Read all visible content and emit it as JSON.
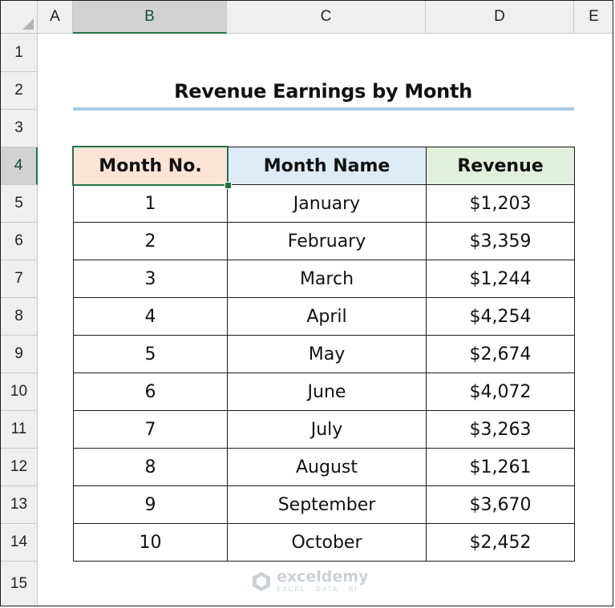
{
  "columns": [
    "A",
    "B",
    "C",
    "D",
    "E"
  ],
  "rows": [
    "1",
    "2",
    "3",
    "4",
    "5",
    "6",
    "7",
    "8",
    "9",
    "10",
    "11",
    "12",
    "13",
    "14",
    "15"
  ],
  "active_column": "B",
  "active_row": "4",
  "title": "Revenue Earnings by Month",
  "table": {
    "headers": [
      "Month No.",
      "Month Name",
      "Revenue"
    ],
    "header_colors": [
      "#fbe3d6",
      "#ddebf7",
      "#e2efda"
    ],
    "rows": [
      [
        "1",
        "January",
        "$1,203"
      ],
      [
        "2",
        "February",
        "$3,359"
      ],
      [
        "3",
        "March",
        "$1,244"
      ],
      [
        "4",
        "April",
        "$4,254"
      ],
      [
        "5",
        "May",
        "$2,674"
      ],
      [
        "6",
        "June",
        "$4,072"
      ],
      [
        "7",
        "July",
        "$3,263"
      ],
      [
        "8",
        "August",
        "$1,261"
      ],
      [
        "9",
        "September",
        "$3,670"
      ],
      [
        "10",
        "October",
        "$2,452"
      ]
    ]
  },
  "watermark": {
    "name": "exceldemy",
    "tagline": "EXCEL · DATA · BI"
  },
  "accent_color": "#217346"
}
